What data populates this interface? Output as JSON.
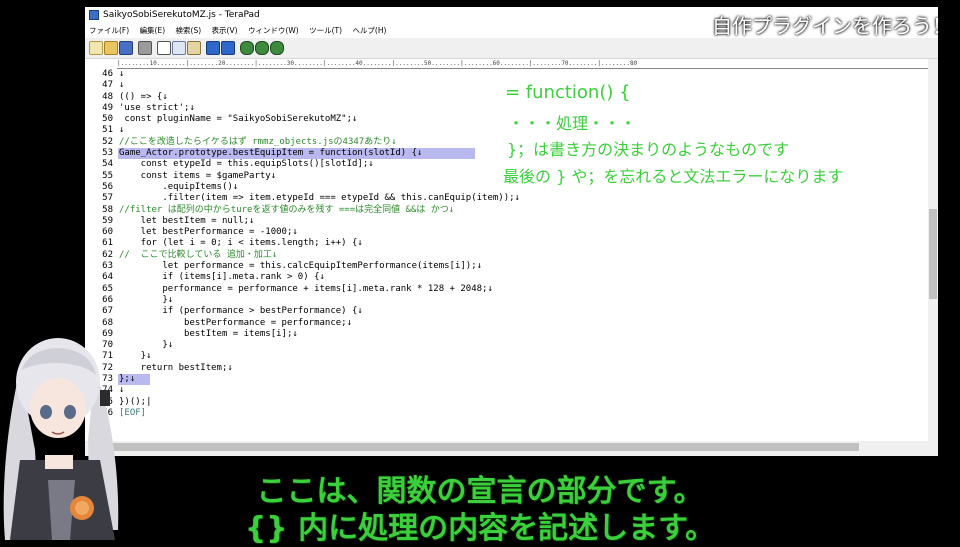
{
  "window": {
    "title": "SaikyoSobiSerekutoMZ.js - TeraPad"
  },
  "menu": [
    "ファイル(F)",
    "編集(E)",
    "検索(S)",
    "表示(V)",
    "ウィンドウ(W)",
    "ツール(T)",
    "ヘルプ(H)"
  ],
  "toolbar_icons": [
    "new-file-icon",
    "open-folder-icon",
    "save-icon",
    "print-icon",
    "cut-icon",
    "copy-icon",
    "paste-icon",
    "undo-icon",
    "redo-icon",
    "find-icon",
    "find-next-icon",
    "find-prev-icon"
  ],
  "ruler": "|........10........|........20........|........30........|........40........|........50........|........60........|........70........|........80",
  "code_lines": [
    {
      "n": "46",
      "t": "↓"
    },
    {
      "n": "47",
      "t": "↓"
    },
    {
      "n": "48",
      "t": "(() => {↓"
    },
    {
      "n": "49",
      "t": "'use strict';↓"
    },
    {
      "n": "50",
      "t": " const pluginName = \"SaikyoSobiSerekutoMZ\";↓"
    },
    {
      "n": "51",
      "t": "↓"
    },
    {
      "n": "52",
      "t": "//ここを改造したらイケるはず rmmz_objects.jsの4347あたり↓",
      "c": "comment"
    },
    {
      "n": "53",
      "t": "Game_Actor.prototype.bestEquipItem = function(slotId) {↓"
    },
    {
      "n": "54",
      "t": "    const etypeId = this.equipSlots()[slotId];↓"
    },
    {
      "n": "55",
      "t": "    const items = $gameParty↓"
    },
    {
      "n": "56",
      "t": "        .equipItems()↓"
    },
    {
      "n": "57",
      "t": "        .filter(item => item.etypeId === etypeId && this.canEquip(item));↓"
    },
    {
      "n": "58",
      "t": "//filter は配列の中からtureを返す値のみを残す ===は完全同値 &&は かつ↓",
      "c": "comment"
    },
    {
      "n": "59",
      "t": "    let bestItem = null;↓"
    },
    {
      "n": "60",
      "t": "    let bestPerformance = -1000;↓"
    },
    {
      "n": "61",
      "t": "    for (let i = 0; i < items.length; i++) {↓"
    },
    {
      "n": "62",
      "t": "//  ここで比較している 追加・加工↓",
      "c": "comment"
    },
    {
      "n": "63",
      "t": "        let performance = this.calcEquipItemPerformance(items[i]);↓"
    },
    {
      "n": "64",
      "t": "        if (items[i].meta.rank > 0) {↓"
    },
    {
      "n": "65",
      "t": "        performance = performance + items[i].meta.rank * 128 + 2048;↓"
    },
    {
      "n": "66",
      "t": "        }↓"
    },
    {
      "n": "67",
      "t": "        if (performance > bestPerformance) {↓"
    },
    {
      "n": "68",
      "t": "            bestPerformance = performance;↓"
    },
    {
      "n": "69",
      "t": "            bestItem = items[i];↓"
    },
    {
      "n": "70",
      "t": "        }↓"
    },
    {
      "n": "71",
      "t": "    }↓"
    },
    {
      "n": "72",
      "t": "    return bestItem;↓"
    },
    {
      "n": "73",
      "t": "};↓"
    },
    {
      "n": "74",
      "t": "↓"
    },
    {
      "n": "75",
      "t": "})();|"
    },
    {
      "n": "76",
      "t": "[EOF]",
      "c": "eof"
    }
  ],
  "annotations": {
    "line1": "= function() {",
    "line2": "・・・処理・・・",
    "line3": "}；は書き方の決まりのようなものです",
    "line4": "最後の } や；を忘れると文法エラーになります"
  },
  "corner_title": "自作プラグインを作ろう！",
  "subtitles": {
    "line1": "ここは、関数の宣言の部分です。",
    "line2": "{} 内に処理の内容を記述します。"
  },
  "colors": {
    "highlight": "#b9b9ef",
    "annotation_green": "#3bd03b",
    "comment_green": "#2b8a2b"
  }
}
